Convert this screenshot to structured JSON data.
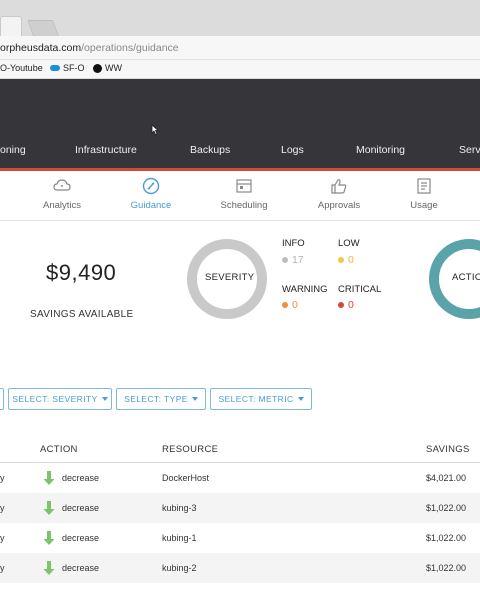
{
  "browser": {
    "url_domain": "orpheusdata.com",
    "url_path": "/operations/guidance",
    "bookmarks": [
      "O-Youtube",
      "SF-O",
      "WW"
    ]
  },
  "main_nav": [
    "oning",
    "Infrastructure",
    "Backups",
    "Logs",
    "Monitoring",
    "Serv"
  ],
  "sub_nav": [
    {
      "label": "Analytics",
      "icon": "analytics-icon"
    },
    {
      "label": "Guidance",
      "icon": "guidance-icon",
      "active": true
    },
    {
      "label": "Scheduling",
      "icon": "scheduling-icon"
    },
    {
      "label": "Approvals",
      "icon": "approvals-icon"
    },
    {
      "label": "Usage",
      "icon": "usage-icon"
    }
  ],
  "summary": {
    "savings_amount": "$9,490",
    "savings_label": "SAVINGS AVAILABLE",
    "severity_donut_label": "SEVERITY",
    "action_donut_label": "ACTIO",
    "severity": {
      "info_label": "INFO",
      "info_value": "17",
      "info_color": "#bdbdbd",
      "low_label": "LOW",
      "low_value": "0",
      "low_color": "#f1c84b",
      "warning_label": "WARNING",
      "warning_value": "0",
      "warning_color": "#ef8f43",
      "critical_label": "CRITICAL",
      "critical_value": "0",
      "critical_color": "#d24a35"
    }
  },
  "filters": {
    "severity": "SELECT: SEVERITY",
    "type": "SELECT: TYPE",
    "metric": "SELECT: METRIC"
  },
  "table": {
    "headers": {
      "action": "ACTION",
      "resource": "RESOURCE",
      "savings": "SAVINGS"
    },
    "rows": [
      {
        "lead": "y",
        "action": "decrease",
        "resource": "DockerHost",
        "savings": "$4,021.00"
      },
      {
        "lead": "y",
        "action": "decrease",
        "resource": "kubing-3",
        "savings": "$1,022.00"
      },
      {
        "lead": "y",
        "action": "decrease",
        "resource": "kubing-1",
        "savings": "$1,022.00"
      },
      {
        "lead": "y",
        "action": "decrease",
        "resource": "kubing-2",
        "savings": "$1,022.00"
      }
    ]
  },
  "colors": {
    "header_bg": "#35353a",
    "accent_red": "#d24a35",
    "accent_blue": "#4a9bd6",
    "action_teal": "#5aa3a8",
    "arrow_green": "#7cc36b"
  }
}
